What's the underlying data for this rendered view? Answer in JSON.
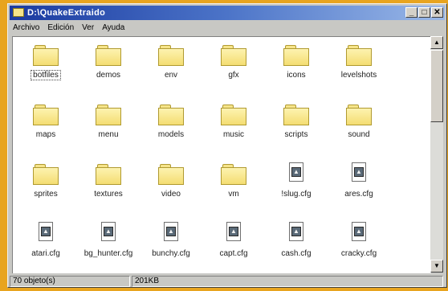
{
  "window": {
    "title": "D:\\QuakeExtraido"
  },
  "title_buttons": {
    "minimize": "_",
    "maximize": "□",
    "close": "✕"
  },
  "menu": {
    "items": [
      "Archivo",
      "Edición",
      "Ver",
      "Ayuda"
    ]
  },
  "items": [
    {
      "name": "botfiles",
      "type": "folder"
    },
    {
      "name": "demos",
      "type": "folder"
    },
    {
      "name": "env",
      "type": "folder"
    },
    {
      "name": "gfx",
      "type": "folder"
    },
    {
      "name": "icons",
      "type": "folder"
    },
    {
      "name": "levelshots",
      "type": "folder"
    },
    {
      "name": "maps",
      "type": "folder"
    },
    {
      "name": "menu",
      "type": "folder"
    },
    {
      "name": "models",
      "type": "folder"
    },
    {
      "name": "music",
      "type": "folder"
    },
    {
      "name": "scripts",
      "type": "folder"
    },
    {
      "name": "sound",
      "type": "folder"
    },
    {
      "name": "sprites",
      "type": "folder"
    },
    {
      "name": "textures",
      "type": "folder"
    },
    {
      "name": "video",
      "type": "folder"
    },
    {
      "name": "vm",
      "type": "folder"
    },
    {
      "name": "!slug.cfg",
      "type": "cfg"
    },
    {
      "name": "ares.cfg",
      "type": "cfg"
    },
    {
      "name": "atari.cfg",
      "type": "cfg"
    },
    {
      "name": "bg_hunter.cfg",
      "type": "cfg"
    },
    {
      "name": "bunchy.cfg",
      "type": "cfg"
    },
    {
      "name": "capt.cfg",
      "type": "cfg"
    },
    {
      "name": "cash.cfg",
      "type": "cfg"
    },
    {
      "name": "cracky.cfg",
      "type": "cfg"
    }
  ],
  "scrollbar": {
    "up": "▲",
    "down": "▼"
  },
  "status": {
    "objects": "70 objeto(s)",
    "size": "201KB"
  }
}
